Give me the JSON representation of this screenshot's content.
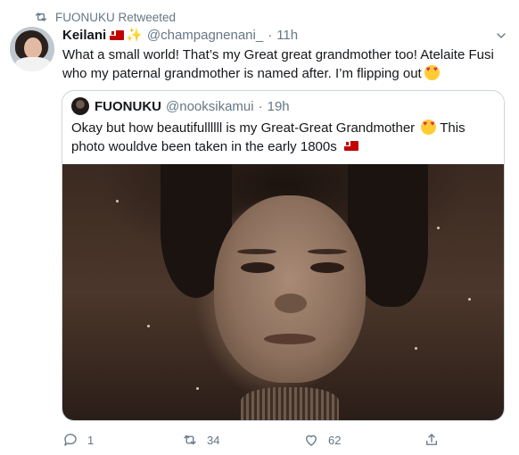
{
  "retweet": {
    "label": "FUONUKU Retweeted",
    "icon": "retweet-icon"
  },
  "tweet": {
    "name": "Keilani",
    "handle": "@champagnenani_",
    "separator": "·",
    "time": "11h",
    "text": "What a small world! That’s my Great great grandmother too! Atelaite Fusi who my paternal grandmother is named after. I’m flipping out",
    "emoji": "heart-eyes-emoji"
  },
  "quote": {
    "name": "FUONUKU",
    "handle": "@nooksikamui",
    "separator": "·",
    "time": "19h",
    "text_part1": "Okay but how beautifullllll is my Great-Great Grandmother",
    "text_part2": "This photo wouldve been taken in the early 1800s",
    "photo_description": "sepia-portrait"
  },
  "actions": {
    "reply_count": "1",
    "retweet_count": "34",
    "like_count": "62"
  },
  "colors": {
    "secondary_text": "#657786",
    "border": "#ccd6dd",
    "text": "#14171a"
  }
}
